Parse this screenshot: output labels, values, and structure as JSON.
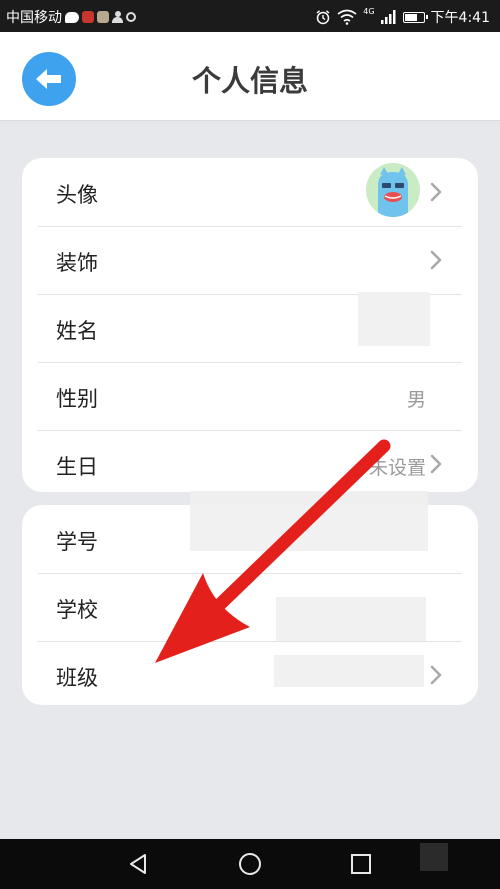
{
  "status_bar": {
    "carrier": "中国移动",
    "network": "4G",
    "time": "下午4:41",
    "battery_level": 0.7
  },
  "header": {
    "title": "个人信息",
    "accent_color": "#3fa2ef"
  },
  "profile_rows": [
    {
      "label": "头像",
      "value": "",
      "has_chevron": true
    },
    {
      "label": "装饰",
      "value": "",
      "has_chevron": true
    },
    {
      "label": "姓名",
      "value": "",
      "has_chevron": false
    },
    {
      "label": "性别",
      "value": "男",
      "has_chevron": false
    },
    {
      "label": "生日",
      "value": "未设置",
      "has_chevron": true
    }
  ],
  "school_rows": [
    {
      "label": "学号",
      "value": "",
      "has_chevron": false
    },
    {
      "label": "学校",
      "value": "",
      "has_chevron": false
    },
    {
      "label": "班级",
      "value": "",
      "has_chevron": true
    }
  ],
  "icons": [
    "back-arrow-icon",
    "chevron-right-icon",
    "avatar",
    "nav-back-icon",
    "nav-home-icon",
    "nav-recents-icon"
  ],
  "annotation_color": "#e3201b"
}
